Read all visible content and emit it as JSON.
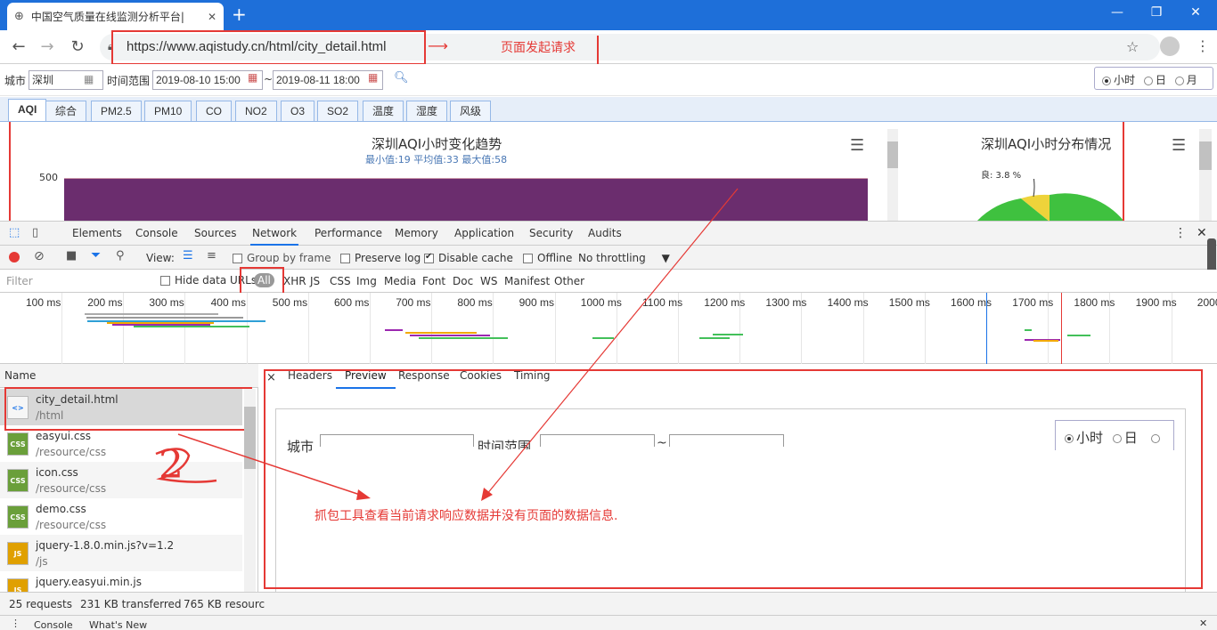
{
  "browser": {
    "tab_title": "中国空气质量在线监测分析平台|",
    "url": "https://www.aqistudy.cn/html/city_detail.html",
    "new_tab": "+"
  },
  "page": {
    "city_label": "城市",
    "city_value": "深圳",
    "range_label": "时间范围",
    "start_time": "2019-08-10 15:00",
    "tilde": "~",
    "end_time": "2019-08-11 18:00",
    "radio_hour": "小时",
    "radio_day": "日",
    "radio_month": "月",
    "tabs": [
      "AQI",
      "综合",
      "PM2.5",
      "PM10",
      "CO",
      "NO2",
      "O3",
      "SO2",
      "温度",
      "湿度",
      "风级"
    ],
    "chart1_title": "深圳AQI小时变化趋势",
    "chart1_subtitle": "最小值:19 平均值:33 最大值:58",
    "chart1_ytick": "500",
    "chart2_title": "深圳AQI小时分布情况",
    "chart2_label": "良: 3.8 %"
  },
  "devtools": {
    "tabs": [
      "Elements",
      "Console",
      "Sources",
      "Network",
      "Performance",
      "Memory",
      "Application",
      "Security",
      "Audits"
    ],
    "view_label": "View:",
    "group_by_frame": "Group by frame",
    "preserve_log": "Preserve log",
    "disable_cache": "Disable cache",
    "offline": "Offline",
    "throttling": "No throttling",
    "filter_placeholder": "Filter",
    "hide_data_urls": "Hide data URLs",
    "types": [
      "All",
      "XHR",
      "JS",
      "CSS",
      "Img",
      "Media",
      "Font",
      "Doc",
      "WS",
      "Manifest",
      "Other"
    ],
    "ticks": [
      "100 ms",
      "200 ms",
      "300 ms",
      "400 ms",
      "500 ms",
      "600 ms",
      "700 ms",
      "800 ms",
      "900 ms",
      "1000 ms",
      "1100 ms",
      "1200 ms",
      "1300 ms",
      "1400 ms",
      "1500 ms",
      "1600 ms",
      "1700 ms",
      "1800 ms",
      "1900 ms",
      "2000"
    ],
    "name_header": "Name",
    "requests": [
      {
        "name": "city_detail.html",
        "path": "/html",
        "icon": "<>"
      },
      {
        "name": "easyui.css",
        "path": "/resource/css",
        "icon": "CSS"
      },
      {
        "name": "icon.css",
        "path": "/resource/css",
        "icon": "CSS"
      },
      {
        "name": "demo.css",
        "path": "/resource/css",
        "icon": "CSS"
      },
      {
        "name": "jquery-1.8.0.min.js?v=1.2",
        "path": "/js",
        "icon": "JS"
      },
      {
        "name": "jquery.easyui.min.js",
        "path": "",
        "icon": "JS"
      }
    ],
    "preview_tabs": [
      "Headers",
      "Preview",
      "Response",
      "Cookies",
      "Timing"
    ],
    "close_x": "×",
    "preview": {
      "city_label": "城市",
      "range_label": "时间范围",
      "tilde": "~",
      "radio_hour": "小时",
      "radio_day": "日"
    },
    "status": {
      "requests": "25 requests",
      "transferred": "231 KB transferred",
      "resources": "765 KB resourc"
    },
    "drawer_tabs": [
      "Console",
      "What's New"
    ]
  },
  "annotations": {
    "request_note": "页面发起请求",
    "response_note": "抓包工具查看当前请求响应数据并没有页面的数据信息.",
    "number_note": "2"
  }
}
